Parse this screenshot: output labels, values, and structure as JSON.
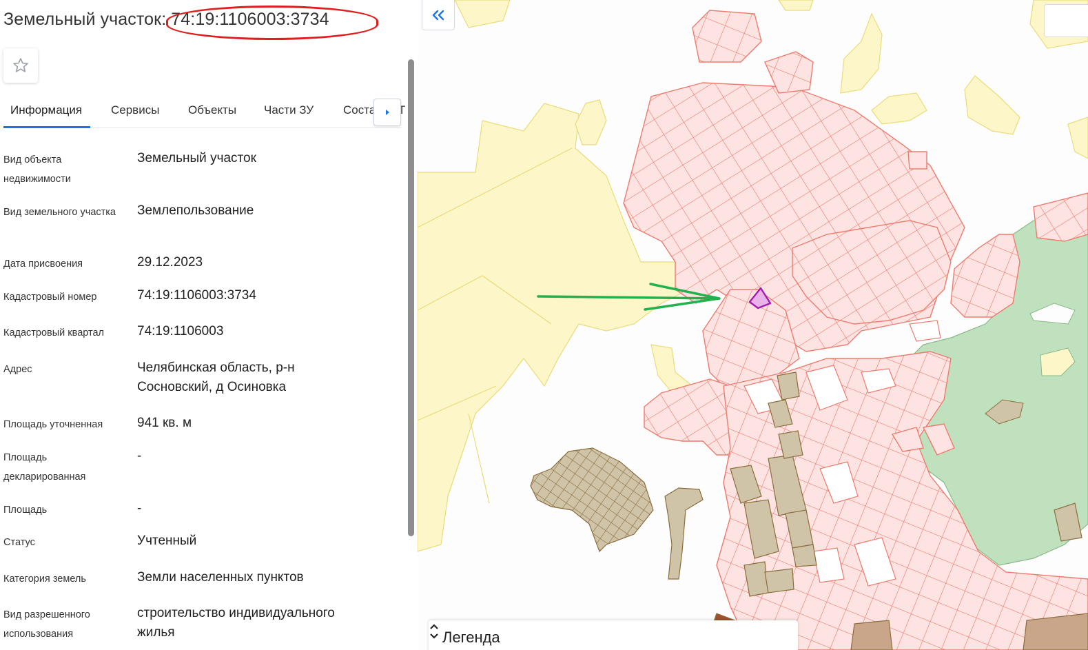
{
  "header": {
    "title_prefix": "Земельный участок: ",
    "cadastral_number": "74:19:1106003:3734"
  },
  "favorite": {
    "icon": "star-outline-icon"
  },
  "tabs": [
    {
      "label": "Информация",
      "active": true
    },
    {
      "label": "Сервисы"
    },
    {
      "label": "Объекты"
    },
    {
      "label": "Части ЗУ"
    },
    {
      "label": "Соста"
    }
  ],
  "tabs_overflow_text": "Т",
  "fields": [
    {
      "label": "Вид объекта недвижимости",
      "value": "Земельный участок"
    },
    {
      "label": "Вид земельного участка",
      "value": "Землепользование"
    },
    {
      "label": "Дата присвоения",
      "value": "29.12.2023"
    },
    {
      "label": "Кадастровый номер",
      "value": "74:19:1106003:3734"
    },
    {
      "label": "Кадастровый квартал",
      "value": "74:19:1106003"
    },
    {
      "label": "Адрес",
      "value": "Челябинская область, р-н Сосновский, д Осиновка"
    },
    {
      "label": "Площадь уточненная",
      "value": "941 кв. м"
    },
    {
      "label": "Площадь декларированная",
      "value": "-"
    },
    {
      "label": "Площадь",
      "value": "-"
    },
    {
      "label": "Статус",
      "value": "Учтенный"
    },
    {
      "label": "Категория земель",
      "value": "Земли населенных пунктов"
    },
    {
      "label": "Вид разрешенного использования",
      "value": "строительство индивидуального жилья"
    }
  ],
  "map": {
    "legend_title": "Легенда",
    "colors": {
      "parcel_fill": "#fde4e2",
      "parcel_stroke": "#ee7b6e",
      "zone_yellow": "#fdf6c9",
      "zone_green": "#bfe1bd",
      "zone_brown": "#cfc3a8",
      "selected": "#a21caf",
      "arrow": "#22b14c",
      "highlight_ring": "#e01e1e",
      "accent": "#1a73e8"
    }
  }
}
